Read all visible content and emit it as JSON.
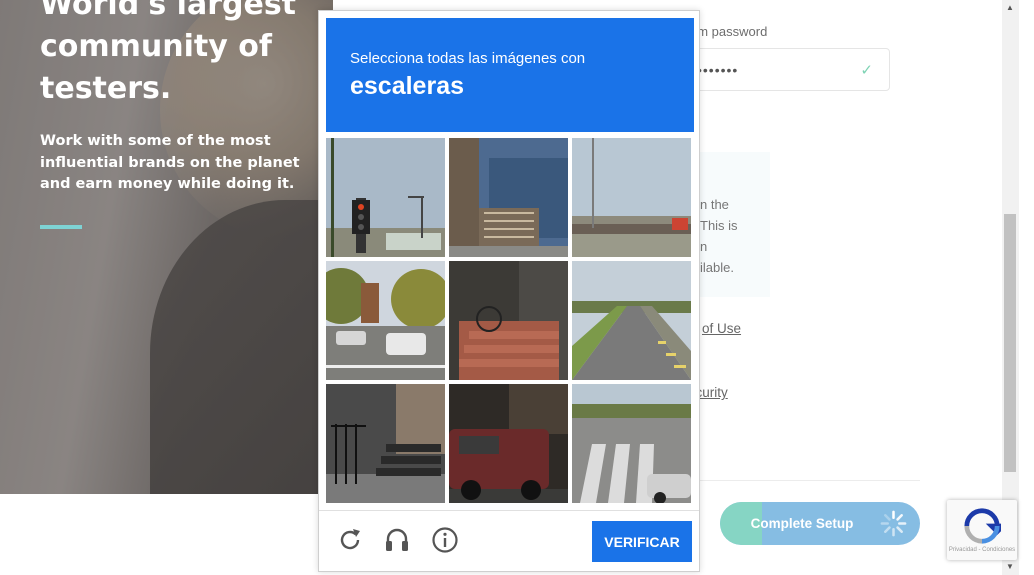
{
  "hero": {
    "title": "World's largest community of testers.",
    "subtitle": "Work with some of the most influential brands on the planet and earn money while doing it."
  },
  "form": {
    "confirm_label": "irm password",
    "password_mask": "•••••••",
    "info_text_lines": [
      "n the",
      "This is",
      "n",
      "ilable."
    ],
    "terms_link": "of Use",
    "security_link": "ecurity",
    "submit_label": "Complete Setup"
  },
  "captcha": {
    "instruction": "Selecciona todas las imágenes con",
    "target": "escaleras",
    "verify_label": "VERIFICAR",
    "icons": [
      "reload-icon",
      "audio-headphones-icon",
      "info-icon"
    ]
  },
  "recaptcha_badge": {
    "terms": "Privacidad - Condiciones"
  },
  "colors": {
    "captcha_blue": "#1a73e8",
    "accent_teal": "#7ed3d4",
    "button_blue": "#86bde3",
    "button_green": "#86d5c4"
  }
}
